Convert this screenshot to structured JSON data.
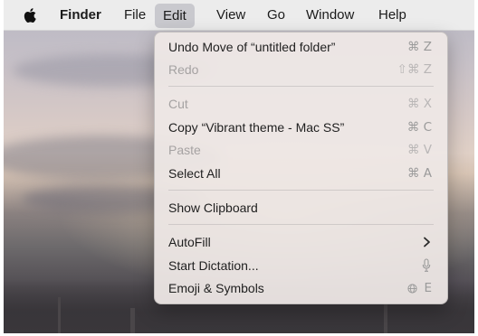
{
  "menubar": {
    "app_name": "Finder",
    "items": [
      "File",
      "Edit",
      "View",
      "Go",
      "Window",
      "Help"
    ],
    "active_item": "Edit"
  },
  "edit_menu": {
    "undo": {
      "label": "Undo Move of “untitled folder”",
      "shortcut": "⌘ Z"
    },
    "redo": {
      "label": "Redo",
      "shortcut": "⇧⌘ Z",
      "disabled": true
    },
    "cut": {
      "label": "Cut",
      "shortcut": "⌘ X",
      "disabled": true
    },
    "copy": {
      "label": "Copy “Vibrant theme - Mac SS”",
      "shortcut": "⌘ C"
    },
    "paste": {
      "label": "Paste",
      "shortcut": "⌘ V",
      "disabled": true
    },
    "select_all": {
      "label": "Select All",
      "shortcut": "⌘ A"
    },
    "show_clipboard": {
      "label": "Show Clipboard"
    },
    "autofill": {
      "label": "AutoFill",
      "icon": "chevron-right-icon"
    },
    "start_dictation": {
      "label": "Start Dictation...",
      "icon": "microphone-icon"
    },
    "emoji_symbols": {
      "label": "Emoji & Symbols",
      "icon": "globe-icon",
      "shortcut_key": "E"
    }
  },
  "colors": {
    "menubar_bg": "#ececec",
    "menu_bg": "#eee8e6",
    "active_highlight": "#c9c9ce",
    "disabled_text": "#a5a2a2"
  }
}
